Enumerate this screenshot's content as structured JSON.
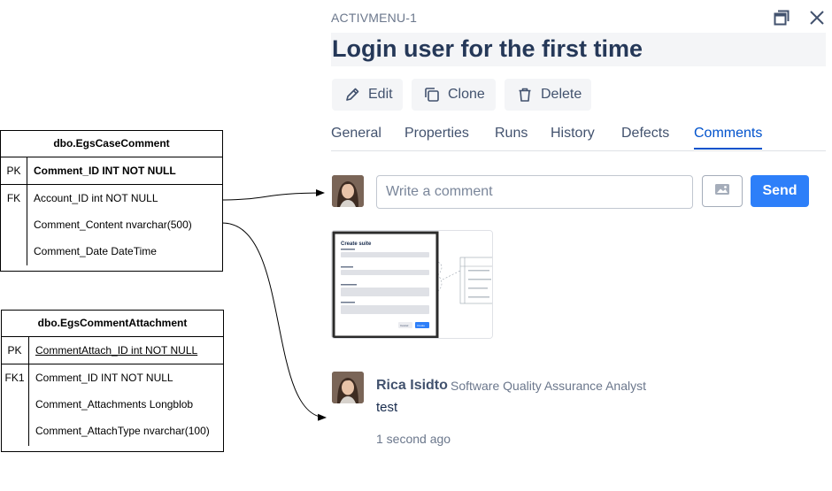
{
  "er_tables": {
    "case_comment": {
      "title": "dbo.EgsCaseComment",
      "pk_key": "PK",
      "pk_field": "Comment_ID INT NOT NULL",
      "fk_key": "FK",
      "fields": [
        "Account_ID int NOT NULL",
        "Comment_Content nvarchar(500)",
        "Comment_Date DateTime"
      ]
    },
    "comment_attachment": {
      "title": "dbo.EgsCommentAttachment",
      "pk_key": "PK",
      "pk_field": "CommentAttach_ID int NOT NULL",
      "fk_key": "FK1",
      "fields": [
        "Comment_ID INT NOT NULL",
        "Comment_Attachments Longblob",
        "Comment_AttachType nvarchar(100)"
      ]
    }
  },
  "panel": {
    "issue_key": "ACTIVMENU-1",
    "title": "Login user for the first time",
    "icons": {
      "restore": "restore-window-icon",
      "close": "close-icon"
    },
    "actions": {
      "edit": "Edit",
      "clone": "Clone",
      "delete": "Delete"
    },
    "tabs": [
      "General",
      "Properties",
      "Runs",
      "History",
      "Defects",
      "Comments"
    ],
    "active_tab": "Comments",
    "comment_box": {
      "placeholder": "Write a comment",
      "send_label": "Send"
    },
    "attachment_preview": {
      "dialog_title": "Create suite",
      "cancel_label": "Cancel",
      "create_label": "Create"
    },
    "comment": {
      "author": "Rica Isidto",
      "role": "Software Quality Assurance Analyst",
      "text": "test",
      "time": "1 second ago"
    },
    "colors": {
      "accent": "#0052cc",
      "send": "#2d7ff9",
      "title_bg": "#f4f5f7"
    }
  }
}
